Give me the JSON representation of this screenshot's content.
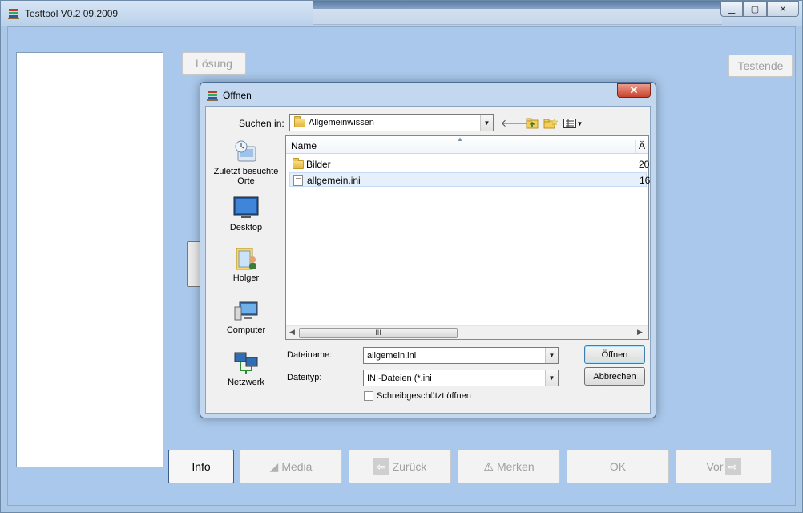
{
  "main_window": {
    "title": "Testtool V0.2 09.2009",
    "buttons": {
      "loesung": "Lösung",
      "testende": "Testende",
      "info": "Info",
      "media": "Media",
      "zurueck": "Zurück",
      "merken": "Merken",
      "ok": "OK",
      "vor": "Vor"
    }
  },
  "dialog": {
    "title": "Öffnen",
    "close_glyph": "✕",
    "look_in_label": "Suchen in:",
    "look_in_value": "Allgemeinwissen",
    "places": [
      {
        "label_line1": "Zuletzt besuchte",
        "label_line2": "Orte",
        "icon": "recent-places-icon"
      },
      {
        "label_line1": "Desktop",
        "icon": "desktop-icon"
      },
      {
        "label_line1": "Holger",
        "icon": "user-folder-icon"
      },
      {
        "label_line1": "Computer",
        "icon": "computer-icon"
      },
      {
        "label_line1": "Netzwerk",
        "icon": "network-icon"
      }
    ],
    "columns": {
      "name": "Name",
      "date": "Ä"
    },
    "files": [
      {
        "name": "Bilder",
        "type": "folder",
        "date_fragment": "20"
      },
      {
        "name": "allgemein.ini",
        "type": "ini",
        "date_fragment": "16"
      }
    ],
    "scrollbar_grip": "III",
    "filename_label": "Dateiname:",
    "filename_value": "allgemein.ini",
    "filetype_label": "Dateityp:",
    "filetype_value": "INI-Dateien (*.ini",
    "readonly_label": "Schreibgeschützt öffnen",
    "readonly_checked": false,
    "open_button": "Öffnen",
    "cancel_button": "Abbrechen"
  },
  "colors": {
    "window_bg": "#abc8e7",
    "close_red": "#c9432b",
    "selection": "#e6f0fb"
  }
}
